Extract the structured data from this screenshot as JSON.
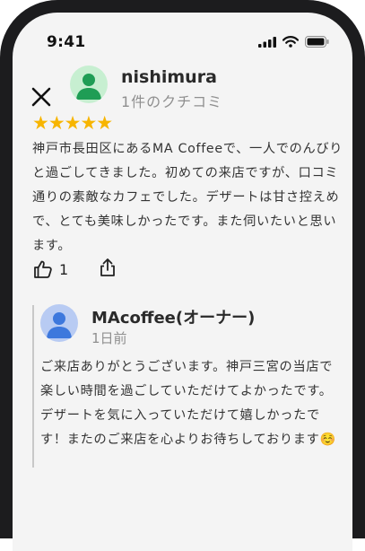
{
  "status_bar": {
    "time": "9:41"
  },
  "review": {
    "user_name": "nishimura",
    "review_count": "1件のクチコミ",
    "stars": "★★★★★",
    "rating": 5,
    "text": "神戸市長田区にあるMA Coffeeで、一人でのんびりと過ごしてきました。初めての来店ですが、口コミ通りの素敵なカフェでした。デザートは甘さ控えめで、とても美味しかったです。また伺いたいと思います。",
    "like_count": "1"
  },
  "owner_reply": {
    "name": "MAcoffee(オーナー)",
    "date": "1日前",
    "text": "ご来店ありがとうございます。神戸三宮の当店で楽しい時間を過ごしていただけてよかったです。デザートを気に入っていただけて嬉しかったです！またのご来店を心よりお待ちしております☺️"
  },
  "colors": {
    "star": "#f7b500",
    "reviewer_avatar_bg": "#c7efd1",
    "reviewer_avatar_fg": "#1f9d55",
    "owner_avatar_bg": "#b8cbf3",
    "owner_avatar_fg": "#3d78dd"
  },
  "icons": [
    "close-icon",
    "thumbs-up-icon",
    "share-icon",
    "signal-icon",
    "wifi-icon",
    "battery-icon"
  ]
}
